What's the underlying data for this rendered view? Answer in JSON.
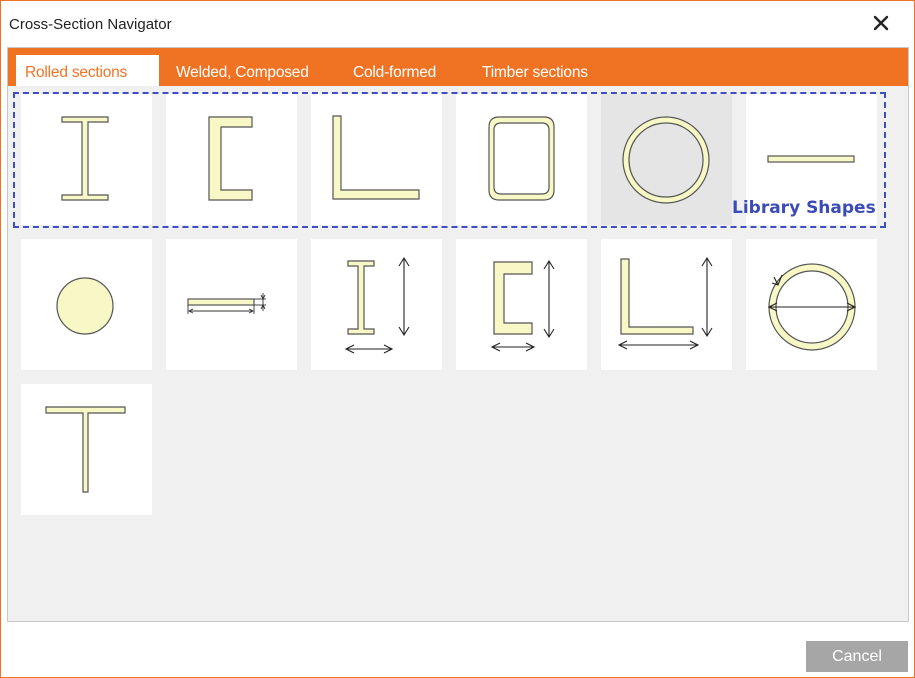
{
  "window": {
    "title": "Cross-Section Navigator"
  },
  "tabs": [
    {
      "label": "Rolled sections",
      "active": true
    },
    {
      "label": "Welded, Composed",
      "active": false
    },
    {
      "label": "Cold-formed",
      "active": false
    },
    {
      "label": "Timber sections",
      "active": false
    }
  ],
  "annotation": {
    "label": "Library Shapes"
  },
  "shapes": [
    {
      "name": "i-beam",
      "icon": "i-section-icon"
    },
    {
      "name": "channel",
      "icon": "channel-section-icon"
    },
    {
      "name": "angle",
      "icon": "angle-section-icon"
    },
    {
      "name": "rectangular-hollow",
      "icon": "rectangular-hollow-section-icon"
    },
    {
      "name": "circular-hollow",
      "icon": "circular-hollow-section-icon"
    },
    {
      "name": "flat-bar",
      "icon": "flat-bar-section-icon"
    },
    {
      "name": "round-bar",
      "icon": "round-bar-section-icon"
    },
    {
      "name": "flat-plate-parametric",
      "icon": "flat-plate-dimensioned-icon"
    },
    {
      "name": "i-beam-parametric",
      "icon": "i-section-dimensioned-icon"
    },
    {
      "name": "channel-parametric",
      "icon": "channel-section-dimensioned-icon"
    },
    {
      "name": "angle-parametric",
      "icon": "angle-section-dimensioned-icon"
    },
    {
      "name": "pipe-parametric",
      "icon": "pipe-section-dimensioned-icon"
    },
    {
      "name": "t-section",
      "icon": "t-section-icon"
    }
  ],
  "footer": {
    "cancel_label": "Cancel"
  },
  "colors": {
    "accent": "#f07324",
    "shape_fill": "#f8f8c6",
    "highlight": "#3f4fc0",
    "cancel_bg": "#a6a6a6"
  }
}
